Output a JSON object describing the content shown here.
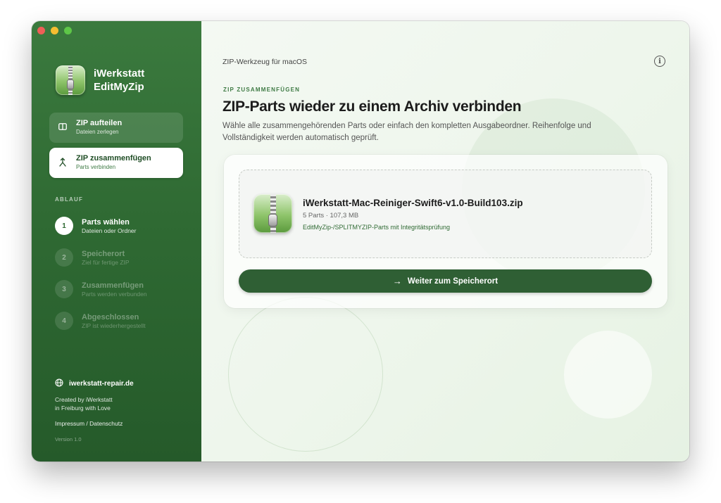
{
  "window": {
    "traffic_lights": [
      "close",
      "minimize",
      "zoom"
    ]
  },
  "sidebar": {
    "brand": {
      "name": "iWerkstatt",
      "product": "EditMyZip",
      "icon": "zip-archive-icon"
    },
    "nav": [
      {
        "id": "split",
        "title": "ZIP aufteilen",
        "subtitle": "Dateien zerlegen",
        "icon": "split-columns-icon",
        "active": false
      },
      {
        "id": "merge",
        "title": "ZIP zusammenfügen",
        "subtitle": "Parts verbinden",
        "icon": "merge-arrows-icon",
        "active": true
      }
    ],
    "section_label": "ABLAUF",
    "steps": [
      {
        "num": "1",
        "title": "Parts wählen",
        "subtitle": "Dateien oder Ordner",
        "active": true
      },
      {
        "num": "2",
        "title": "Speicherort",
        "subtitle": "Ziel für fertige ZIP",
        "active": false
      },
      {
        "num": "3",
        "title": "Zusammenfügen",
        "subtitle": "Parts werden verbunden",
        "active": false
      },
      {
        "num": "4",
        "title": "Abgeschlossen",
        "subtitle": "ZIP ist wiederhergestellt",
        "active": false
      }
    ],
    "footer": {
      "website": "iwerkstatt-repair.de",
      "credit_line1": "Created by iWerkstatt",
      "credit_line2": "in Freiburg with Love",
      "legal": "Impressum / Datenschutz",
      "version": "Version 1.0"
    }
  },
  "main": {
    "app_title": "ZIP-Werkzeug für macOS",
    "info_label": "i",
    "eyebrow": "ZIP ZUSAMMENFÜGEN",
    "heading": "ZIP-Parts wieder zu einem Archiv verbinden",
    "description": "Wähle alle zusammengehörenden Parts oder einfach den kompletten Ausgabeordner. Reihenfolge und Vollständigkeit werden automatisch geprüft.",
    "file": {
      "name": "iWerkstatt-Mac-Reiniger-Swift6-v1.0-Build103.zip",
      "meta": "5 Parts · 107,3 MB",
      "note": "EditMyZip-/SPLITMYZIP-Parts mit Integritätsprüfung"
    },
    "cta": {
      "arrow": "→",
      "label": "Weiter zum Speicherort"
    }
  },
  "colors": {
    "sidebar_green": "#2f6a33",
    "accent_green": "#2f5f34",
    "text_dark": "#1c1c1c"
  }
}
